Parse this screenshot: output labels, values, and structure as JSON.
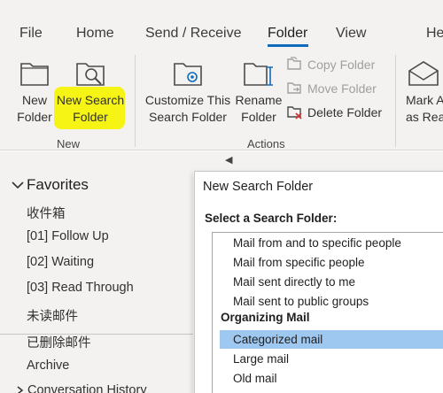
{
  "ribbon_tabs": [
    "File",
    "Home",
    "Send / Receive",
    "Folder",
    "View",
    "He"
  ],
  "ribbon": {
    "new_folder": "New\nFolder",
    "new_search_folder": "New Search\nFolder",
    "group_new": "New",
    "customize_search_folder": "Customize This\nSearch Folder",
    "rename_folder": "Rename\nFolder",
    "copy_folder": "Copy Folder",
    "move_folder": "Move Folder",
    "delete_folder": "Delete Folder",
    "group_actions": "Actions",
    "mark_all": "Mark A\nas Rea"
  },
  "nav": {
    "favorites": "Favorites",
    "items": [
      "收件箱",
      "[01] Follow Up",
      "[02] Waiting",
      "[03] Read Through",
      "未读邮件",
      "已删除邮件",
      "Archive",
      "Conversation History"
    ]
  },
  "dialog": {
    "title": "New Search Folder",
    "prompt": "Select a Search Folder:",
    "items_top": [
      "Mail from and to specific people",
      "Mail from specific people",
      "Mail sent directly to me",
      "Mail sent to public groups"
    ],
    "group_organizing": "Organizing Mail",
    "items_org": [
      "Categorized mail",
      "Large mail",
      "Old mail"
    ]
  },
  "colors": {
    "accent": "#0f6cbd",
    "highlight": "#f6f414",
    "selection": "#9fc8f0",
    "ribbon_bg": "#f3f2f1"
  }
}
